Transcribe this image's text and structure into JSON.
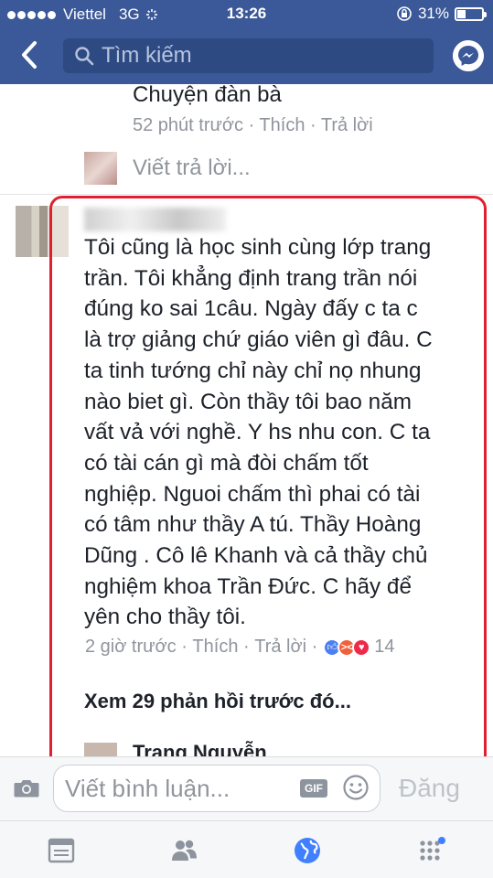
{
  "status_bar": {
    "carrier": "Viettel",
    "network": "3G",
    "time": "13:26",
    "battery": "31%"
  },
  "nav": {
    "search_placeholder": "Tìm kiếm",
    "icons": [
      "back-chevron-icon",
      "search-icon",
      "messenger-icon"
    ]
  },
  "previous_comment": {
    "text": "Chuyện đàn bà",
    "meta": "52 phút trước · Thích · Trả lời"
  },
  "reply_prompt": "Viết trả lời...",
  "comment": {
    "author": "",
    "lines": [
      "Tôi cũng là học sinh cùng lớp trang",
      "trần. Tôi khẳng định trang trần nói",
      "đúng ko sai 1câu. Ngày đấy c ta c",
      "là trợ giảng chứ giáo viên gì đâu. C",
      "ta tinh tướng chỉ này chỉ nọ nhung",
      "nào biet gì. Còn thầy tôi bao năm",
      "vất vả với nghề. Y hs nhu con. C ta",
      "có tài cán gì mà đòi chấm tốt",
      "nghiệp. Nguoi chấm thì phai có tài",
      "có tâm như thầy A tú. Thầy Hoàng",
      "Dũng . Cô lê Khanh và cả thầy chủ",
      "nghiệm khoa Trần Đức. C hãy để",
      "yên cho thầy tôi."
    ],
    "time": "2 giờ trước",
    "like": "Thích",
    "reply": "Trả lời",
    "reaction_count": "14",
    "reactions": [
      "like-icon",
      "angry-icon",
      "love-icon"
    ]
  },
  "more_replies": "Xem 29 phản hồi trước đó...",
  "next_comment_author": "Trang Nguyễn",
  "composer": {
    "placeholder": "Viết bình luận...",
    "gif": "GIF",
    "post": "Đăng"
  },
  "colors": {
    "brand": "#3b5998",
    "highlight": "#e02030",
    "muted": "#90949c"
  }
}
